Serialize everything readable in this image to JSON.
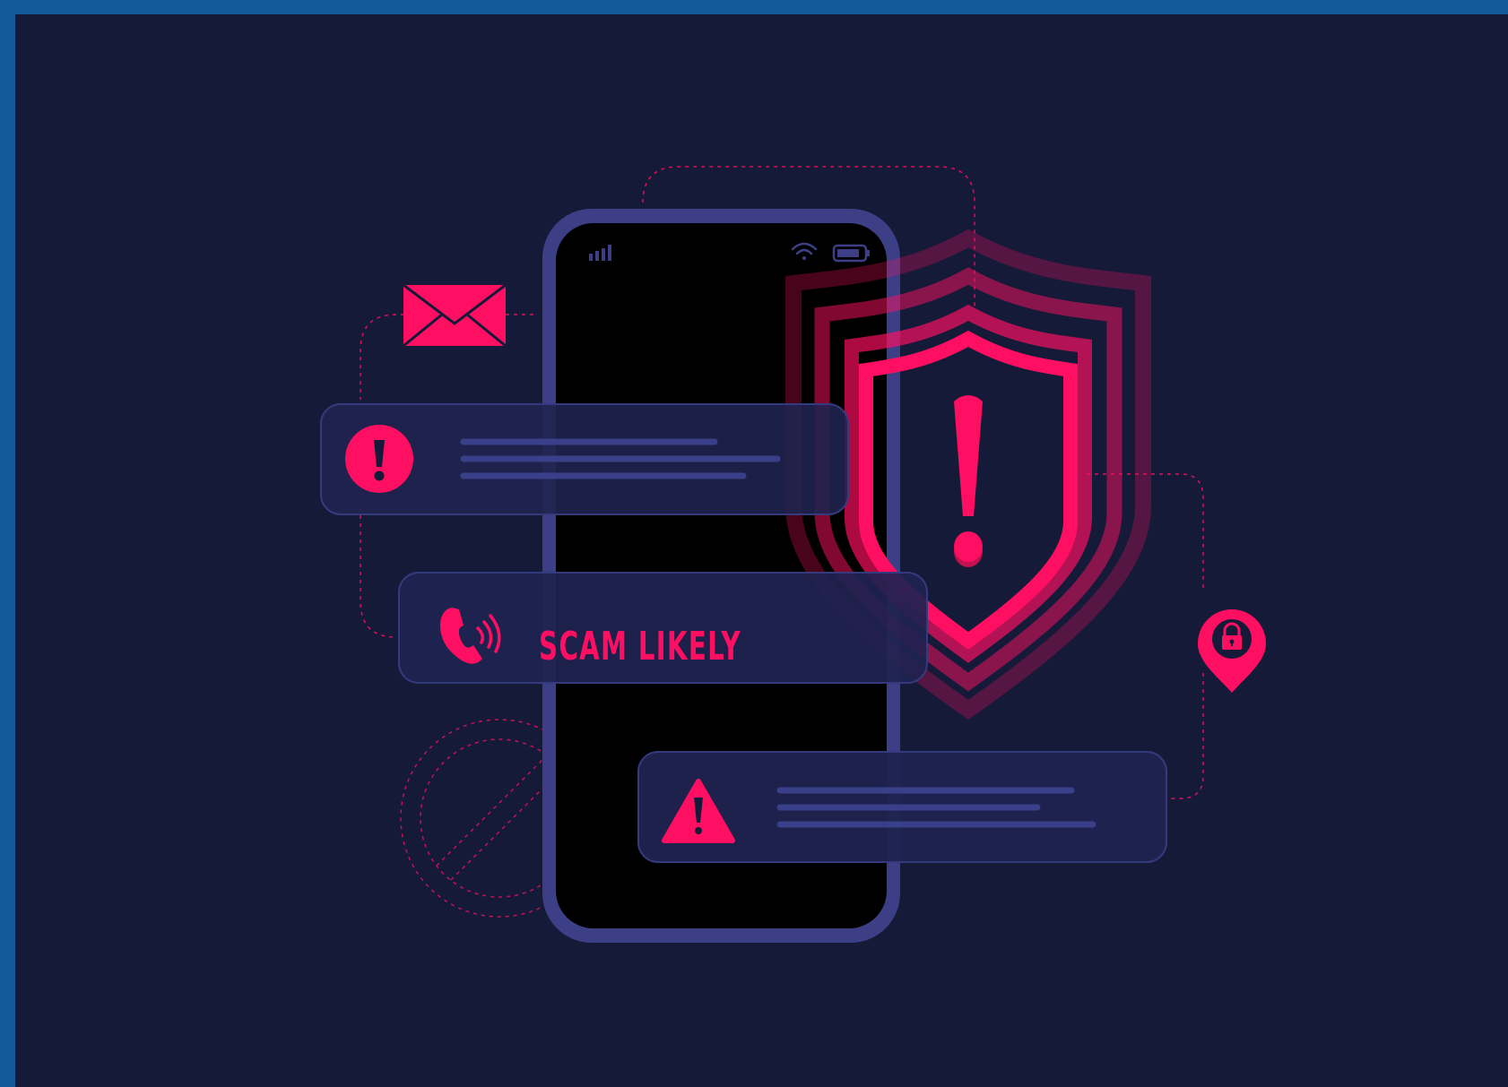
{
  "colors": {
    "frame": "#14599a",
    "background": "#151a38",
    "accent": "#ff0f62",
    "phone_border": "#3c3f86",
    "phone_screen": "#000000",
    "card_fill": "#1f2350",
    "card_border": "#353a7e",
    "text_placeholder": "#393f88"
  },
  "phone": {
    "status_icons": [
      "signal-icon",
      "wifi-icon",
      "battery-icon"
    ]
  },
  "notifications": {
    "alert": {
      "icon": "exclamation-circle-icon"
    },
    "call": {
      "icon": "phone-ringing-icon",
      "label": "SCAM LIKELY"
    },
    "warning": {
      "icon": "warning-triangle-icon"
    }
  },
  "decorations": {
    "icons": [
      "envelope-icon",
      "shield-warning-icon",
      "location-lock-pin-icon",
      "blocked-sign-icon"
    ]
  }
}
